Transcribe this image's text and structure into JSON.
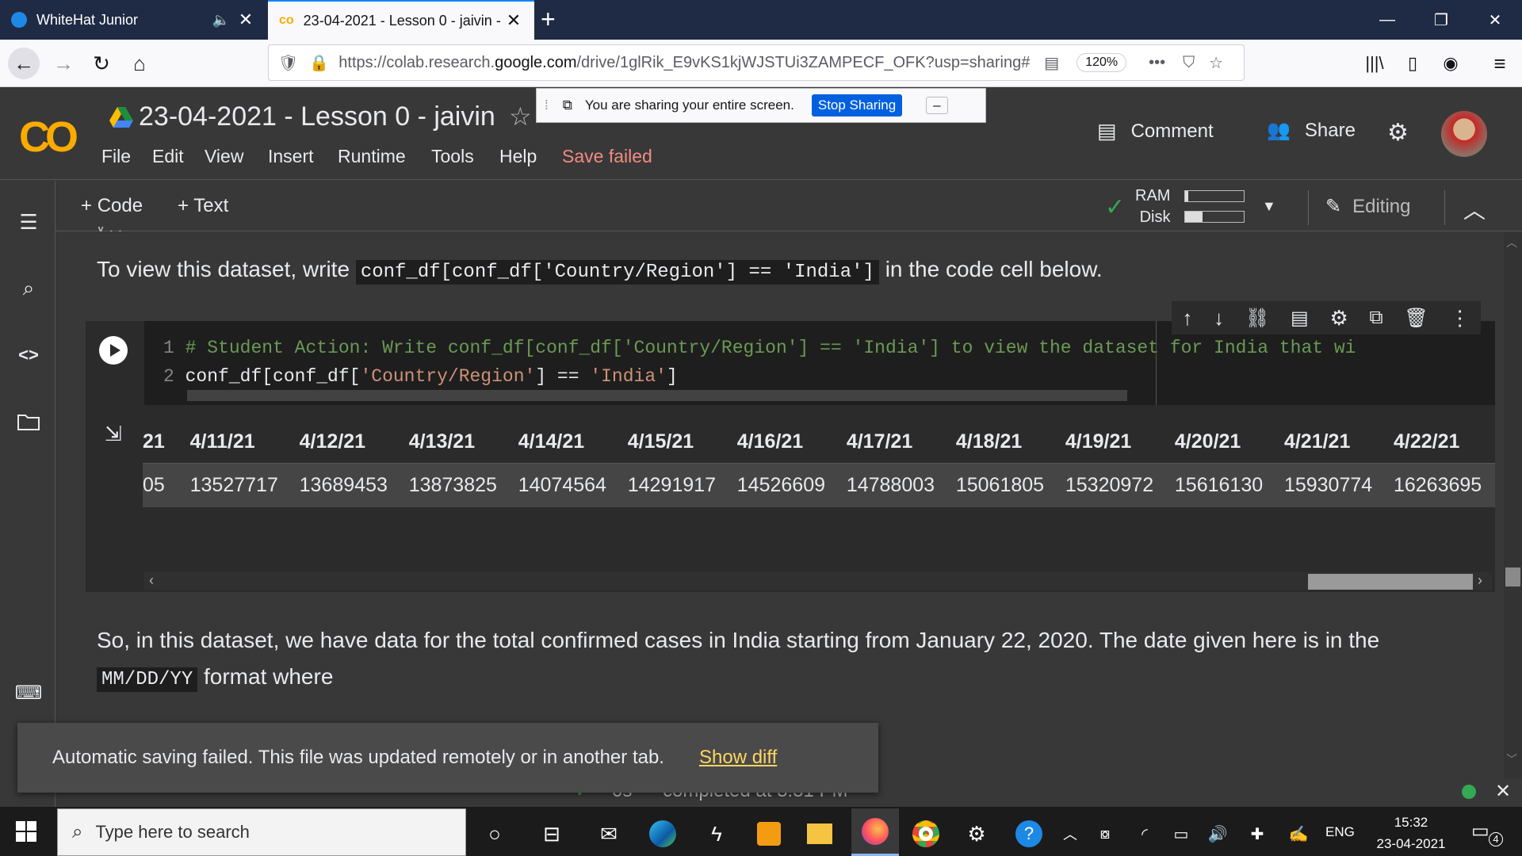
{
  "browser": {
    "tabs": [
      {
        "title": "WhiteHat Junior",
        "active": false
      },
      {
        "title": "23-04-2021 - Lesson 0 - jaivin -",
        "active": true
      }
    ],
    "url_prefix": "https://colab.research.",
    "url_domain": "google.com",
    "url_path": "/drive/1glRik_E9vKS1kjWJSTUi3ZAMPECF_OFK?usp=sharing#",
    "zoom": "120%"
  },
  "sharing_banner": {
    "text": "You are sharing your entire screen.",
    "stop_label": "Stop Sharing"
  },
  "colab": {
    "notebook_title": "23-04-2021 - Lesson 0 - jaivin",
    "menu": [
      "File",
      "Edit",
      "View",
      "Insert",
      "Runtime",
      "Tools",
      "Help"
    ],
    "save_status": "Save failed",
    "comment_label": "Comment",
    "share_label": "Share",
    "add_code_label": "Code",
    "add_text_label": "Text",
    "ram_label": "RAM",
    "disk_label": "Disk",
    "ram_usage": 0.05,
    "disk_usage": 0.3,
    "editing_label": "Editing"
  },
  "content": {
    "instruction_pre": "To view this dataset, write",
    "instruction_code": "conf_df[conf_df['Country/Region'] == 'India']",
    "instruction_post": "in the code cell below.",
    "code_lines": [
      {
        "no": "1",
        "comment": "# Student Action: Write conf_df[conf_df['Country/Region'] == 'India'] to view the dataset for India that wi"
      },
      {
        "no": "2",
        "plain_a": "conf_df[conf_df[",
        "str_a": "'Country/Region'",
        "plain_b": "] == ",
        "str_b": "'India'",
        "plain_c": "]"
      }
    ],
    "table": {
      "headers": [
        "21",
        "4/11/21",
        "4/12/21",
        "4/13/21",
        "4/14/21",
        "4/15/21",
        "4/16/21",
        "4/17/21",
        "4/18/21",
        "4/19/21",
        "4/20/21",
        "4/21/21",
        "4/22/21"
      ],
      "row": [
        "05",
        "13527717",
        "13689453",
        "13873825",
        "14074564",
        "14291917",
        "14526609",
        "14788003",
        "15061805",
        "15320972",
        "15616130",
        "15930774",
        "16263695"
      ]
    },
    "para2_line1": "So, in this dataset, we have data for the total confirmed cases in India starting from January 22, 2020. The date given here is in the",
    "para2_code": "MM/DD/YY",
    "para2_line2": "format where"
  },
  "toast": {
    "message": "Automatic saving failed. This file was updated remotely or in another tab.",
    "action": "Show diff"
  },
  "status": {
    "elapsed": "0s",
    "completed": "completed at 3:31 PM"
  },
  "taskbar": {
    "search_placeholder": "Type here to search",
    "lang": "ENG",
    "time": "15:32",
    "date": "23-04-2021",
    "notifications": "4"
  }
}
